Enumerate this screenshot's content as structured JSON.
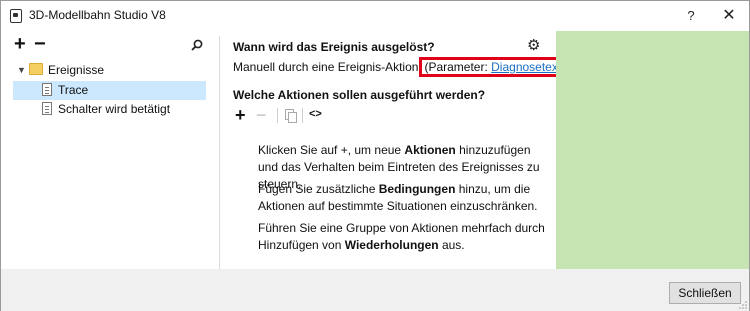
{
  "window": {
    "title": "3D-Modellbahn Studio V8",
    "help_label": "?",
    "close_label": "✕"
  },
  "tree": {
    "add_label": "+",
    "remove_label": "−",
    "root": {
      "label": "Ereignisse",
      "expanded": true
    },
    "items": [
      {
        "label": "Trace",
        "selected": true
      },
      {
        "label": "Schalter wird betätigt",
        "selected": false
      }
    ]
  },
  "trigger": {
    "heading": "Wann wird das Ereignis ausgelöst?",
    "description": "Manuell durch eine Ereignis-Aktion",
    "param_prefix": "Parameter: ",
    "param_link": "Diagnosetext",
    "param_suffix": ")."
  },
  "actions": {
    "heading": "Welche Aktionen sollen ausgeführt werden?",
    "add_label": "+",
    "remove_label": "−",
    "code_label": "<>"
  },
  "help": {
    "p1_a": "Klicken Sie auf +, um neue ",
    "p1_b": "Aktionen",
    "p1_c": " hinzuzufügen und das Verhalten beim Eintreten des Ereignisses zu steuern.",
    "p2_a": "Fügen Sie zusätzliche ",
    "p2_b": "Bedingungen",
    "p2_c": " hinzu, um die Aktionen auf bestimmte Situationen einzuschränken.",
    "p3_a": "Führen Sie eine Gruppe von Aktionen mehrfach durch Hinzufügen von ",
    "p3_b": "Wiederholungen",
    "p3_c": " aus."
  },
  "footer": {
    "close_button": "Schließen"
  },
  "colors": {
    "selection": "#cce8ff",
    "highlight_border": "#e0001a",
    "link": "#1a6fc4",
    "side_panel": "#c5e4b2"
  },
  "icons": [
    "app-icon",
    "search-icon",
    "folder-icon",
    "document-icon",
    "gear-icon",
    "copy-icon",
    "code-icon"
  ]
}
